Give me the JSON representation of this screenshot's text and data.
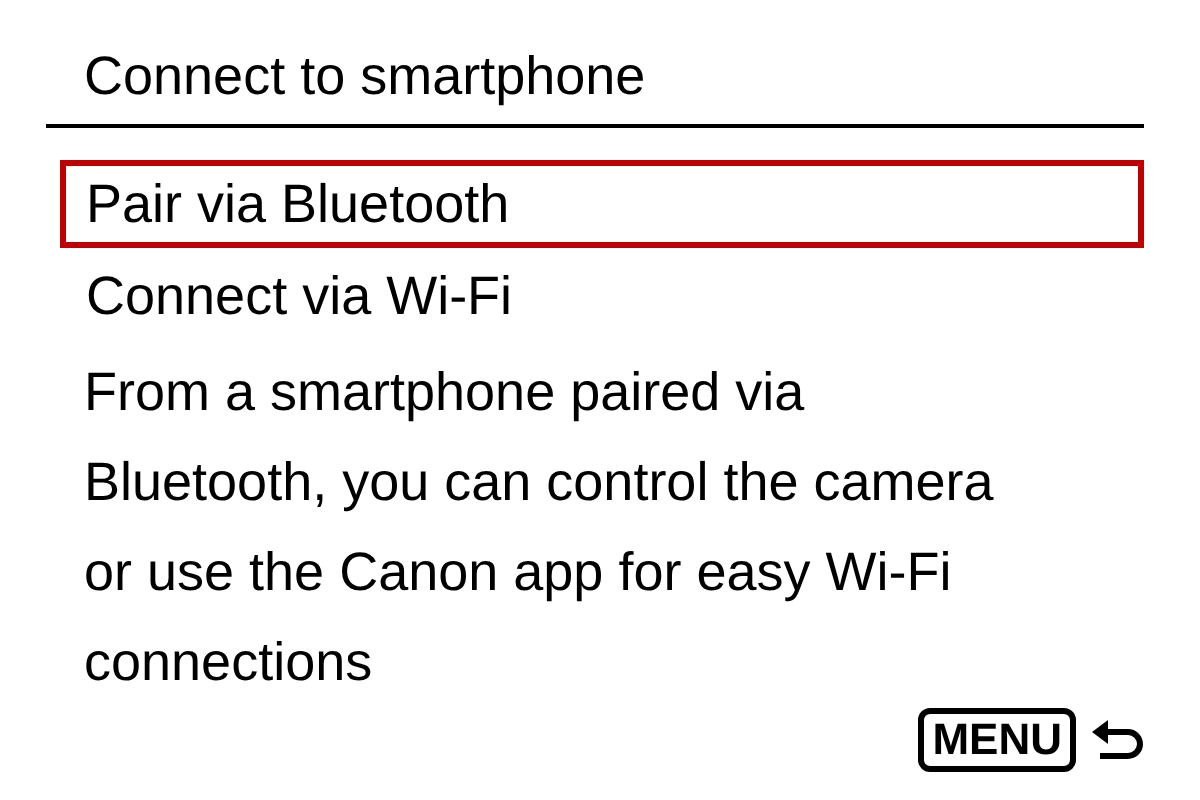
{
  "title": "Connect to smartphone",
  "options": [
    {
      "label": "Pair via Bluetooth",
      "selected": true
    },
    {
      "label": "Connect via Wi-Fi",
      "selected": false
    }
  ],
  "description": "From a smartphone paired via Bluetooth, you can control the camera or use the Canon app for easy Wi-Fi connections",
  "footer": {
    "menu_key": "MENU"
  }
}
